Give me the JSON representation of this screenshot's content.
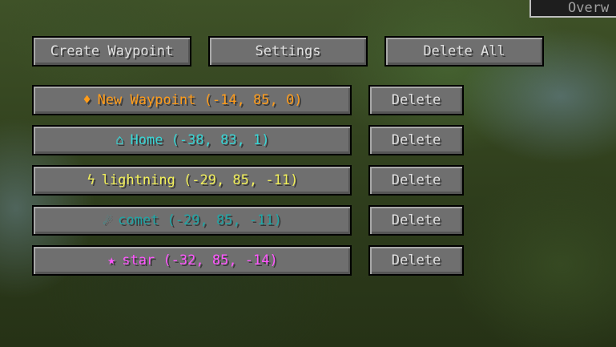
{
  "dimension_tab": {
    "label": "Overw"
  },
  "toolbar": {
    "create_label": "Create Waypoint",
    "settings_label": "Settings",
    "delete_all_label": "Delete All"
  },
  "waypoints": [
    {
      "icon": "diamond-icon",
      "glyph": "♦",
      "label": "New Waypoint (-14, 85, 0)",
      "color": "#ff9c1a",
      "delete_label": "Delete"
    },
    {
      "icon": "home-icon",
      "glyph": "⌂",
      "label": "Home (-38, 83, 1)",
      "color": "#37d6d6",
      "delete_label": "Delete"
    },
    {
      "icon": "lightning-icon",
      "glyph": "ϟ",
      "label": "lightning (-29, 85, -11)",
      "color": "#f2f05a",
      "delete_label": "Delete"
    },
    {
      "icon": "comet-icon",
      "glyph": "☄",
      "label": "comet (-29, 85, -11)",
      "color": "#1fa6a6",
      "delete_label": "Delete"
    },
    {
      "icon": "star-icon",
      "glyph": "★",
      "label": "star (-32, 85, -14)",
      "color": "#ff55ff",
      "delete_label": "Delete"
    }
  ]
}
